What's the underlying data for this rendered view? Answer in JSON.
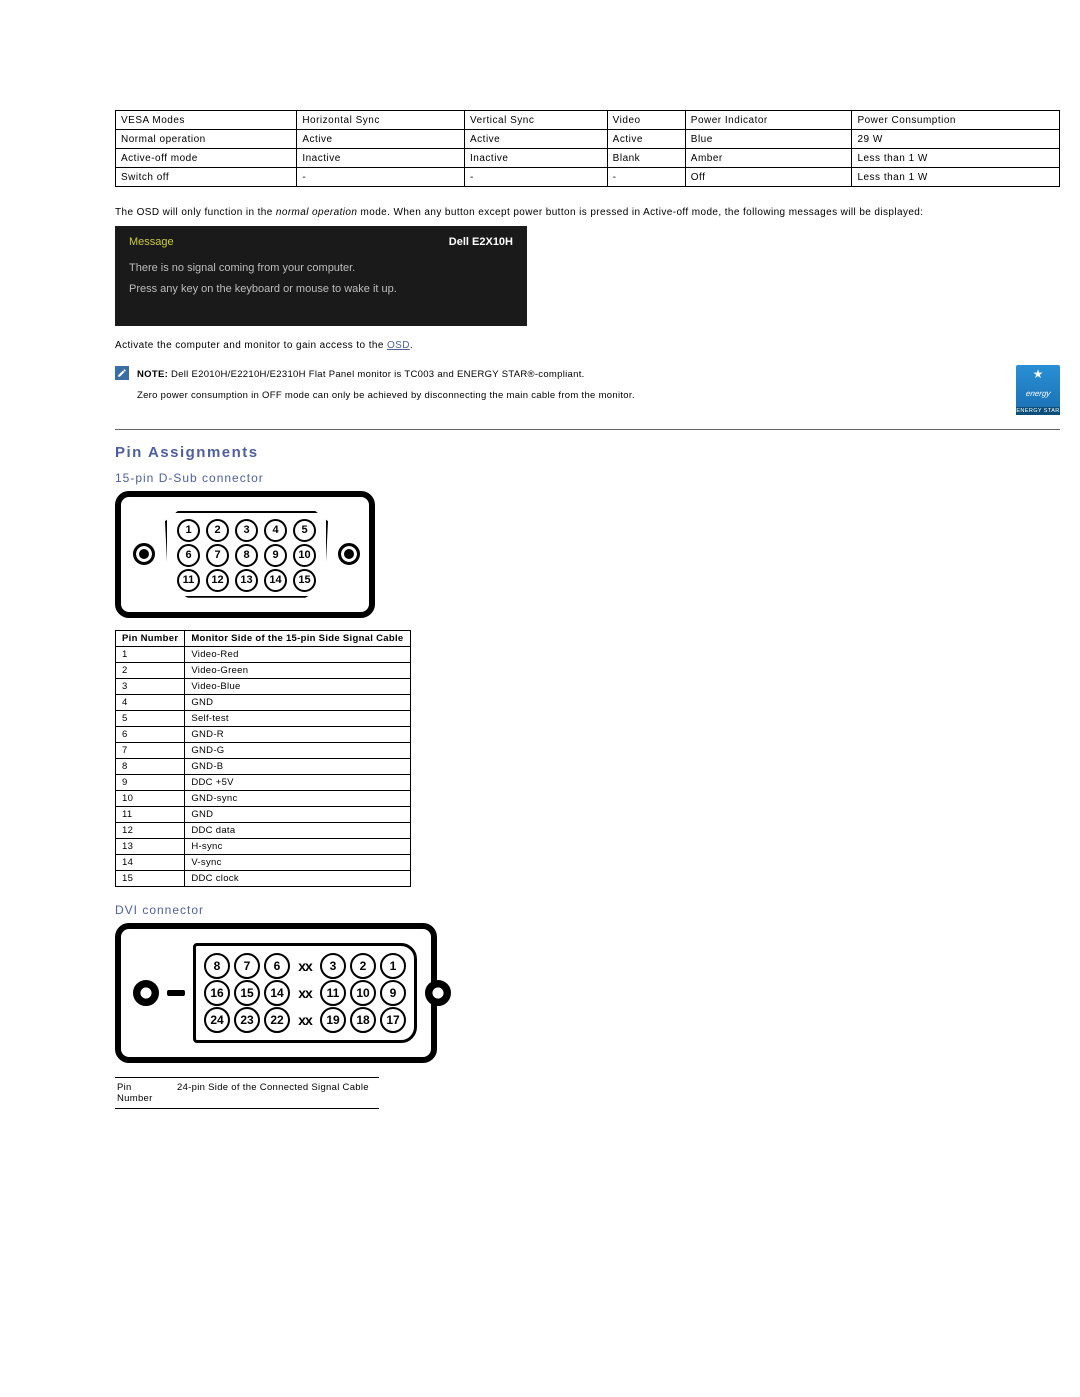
{
  "vesa_table": {
    "headers": [
      "VESA Modes",
      "Horizontal Sync",
      "Vertical Sync",
      "Video",
      "Power Indicator",
      "Power Consumption"
    ],
    "rows": [
      [
        "Normal operation",
        "Active",
        "Active",
        "Active",
        "Blue",
        "29 W"
      ],
      [
        "Active-off mode",
        "Inactive",
        "Inactive",
        "Blank",
        "Amber",
        "Less than 1 W"
      ],
      [
        "Switch off",
        "-",
        "-",
        "-",
        "Off",
        "Less than 1 W"
      ]
    ]
  },
  "osd_intro_prefix": "The OSD will only function in the ",
  "osd_intro_italic": "normal operation",
  "osd_intro_suffix": " mode. When any button except power button is pressed in Active-off mode, the following messages will be displayed:",
  "osd": {
    "message_label": "Message",
    "model": "Dell E2X10H",
    "line1": "There is no signal coming from your computer.",
    "line2": "Press any key on the keyboard or mouse to wake it up."
  },
  "activate_prefix": "Activate the computer and monitor to gain access to the ",
  "activate_link": "OSD",
  "activate_suffix": ".",
  "note": {
    "label": "NOTE:",
    "line1": " Dell E2010H/E2210H/E2310H Flat Panel monitor is TC003 and ENERGY STAR®-compliant.",
    "line2": "Zero power consumption in OFF mode can only be achieved by disconnecting the main cable from the monitor."
  },
  "energy_star": {
    "script": "energy",
    "bar": "ENERGY STAR"
  },
  "pin_assignments_heading": "Pin Assignments",
  "dsub_heading": "15-pin D-Sub connector",
  "dsub_rows": [
    [
      "1",
      "2",
      "3",
      "4",
      "5"
    ],
    [
      "6",
      "7",
      "8",
      "9",
      "10"
    ],
    [
      "11",
      "12",
      "13",
      "14",
      "15"
    ]
  ],
  "dsub_table": {
    "headers": [
      "Pin Number",
      "Monitor Side of the 15-pin Side Signal Cable"
    ],
    "rows": [
      [
        "1",
        "Video-Red"
      ],
      [
        "2",
        "Video-Green"
      ],
      [
        "3",
        "Video-Blue"
      ],
      [
        "4",
        "GND"
      ],
      [
        "5",
        "Self-test"
      ],
      [
        "6",
        "GND-R"
      ],
      [
        "7",
        "GND-G"
      ],
      [
        "8",
        "GND-B"
      ],
      [
        "9",
        "DDC +5V"
      ],
      [
        "10",
        "GND-sync"
      ],
      [
        "11",
        "GND"
      ],
      [
        "12",
        "DDC data"
      ],
      [
        "13",
        "H-sync"
      ],
      [
        "14",
        "V-sync"
      ],
      [
        "15",
        "DDC clock"
      ]
    ]
  },
  "dvi_heading": "DVI connector",
  "dvi_rows": [
    [
      "8",
      "7",
      "6",
      "xx",
      "3",
      "2",
      "1"
    ],
    [
      "16",
      "15",
      "14",
      "xx",
      "11",
      "10",
      "9"
    ],
    [
      "24",
      "23",
      "22",
      "xx",
      "19",
      "18",
      "17"
    ]
  ],
  "dvi_table": {
    "headers": [
      "Pin Number",
      "24-pin Side of the Connected Signal Cable"
    ]
  }
}
